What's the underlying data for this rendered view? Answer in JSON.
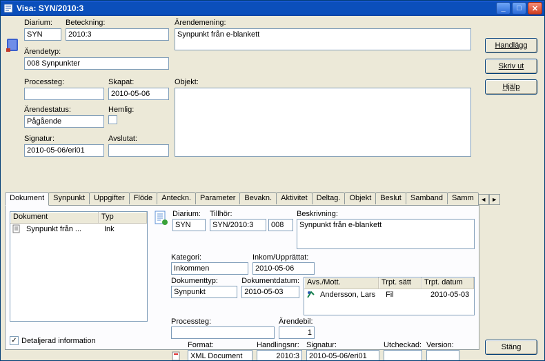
{
  "window": {
    "title": "Visa: SYN/2010:3"
  },
  "buttons": {
    "handlagg": "Handlägg",
    "skrivut": "Skriv ut",
    "hjalp": "Hjälp",
    "stang": "Stäng"
  },
  "top": {
    "labels": {
      "diarium": "Diarium:",
      "beteckning": "Beteckning:",
      "arendemening": "Ärendemening:",
      "arendetyp": "Ärendetyp:",
      "processteg": "Processteg:",
      "skapat": "Skapat:",
      "objekt": "Objekt:",
      "arendestatus": "Ärendestatus:",
      "hemlig": "Hemlig:",
      "signatur": "Signatur:",
      "avslutat": "Avslutat:"
    },
    "values": {
      "diarium": "SYN",
      "beteckning": "2010:3",
      "arendemening": "Synpunkt från e-blankett",
      "arendetyp": "008 Synpunkter",
      "processteg": "",
      "skapat": "2010-05-06",
      "objekt": "",
      "arendestatus": "Pågående",
      "signatur": "2010-05-06/eri01",
      "avslutat": ""
    }
  },
  "tabs": [
    "Dokument",
    "Synpunkt",
    "Uppgifter",
    "Flöde",
    "Anteckn.",
    "Parameter",
    "Bevakn.",
    "Aktivitet",
    "Deltag.",
    "Objekt",
    "Beslut",
    "Samband",
    "Samm"
  ],
  "activeTab": 0,
  "doclist": {
    "cols": [
      "Dokument",
      "Typ"
    ],
    "rows": [
      {
        "dokument": "Synpunkt från ...",
        "typ": "Ink"
      }
    ]
  },
  "detail": {
    "labels": {
      "diarium": "Diarium:",
      "tillhor": "Tillhör:",
      "beskrivning": "Beskrivning:",
      "kategori": "Kategori:",
      "inkom": "Inkom/Upprättat:",
      "doktyp": "Dokumenttyp:",
      "dokdatum": "Dokumentdatum:",
      "processteg": "Processteg:",
      "arendebil": "Ärendebil:",
      "format": "Format:",
      "handlingsnr": "Handlingsnr:",
      "signatur": "Signatur:",
      "utcheckad": "Utcheckad:",
      "version": "Version:"
    },
    "values": {
      "diarium": "SYN",
      "tillhor1": "SYN/2010:3",
      "tillhor2": "008",
      "beskrivning": "Synpunkt från e-blankett",
      "kategori": "Inkommen",
      "inkom": "2010-05-06",
      "doktyp": "Synpunkt",
      "dokdatum": "2010-05-03",
      "processteg": "",
      "arendebil": "1",
      "format": "XML Document",
      "handlingsnr": "2010:3",
      "signatur": "2010-05-06/eri01",
      "utcheckad": "",
      "version": ""
    },
    "recipients": {
      "cols": [
        "Avs./Mott.",
        "Trpt. sätt",
        "Trpt. datum"
      ],
      "rows": [
        {
          "name": "Andersson, Lars",
          "satt": "Fil",
          "datum": "2010-05-03"
        }
      ]
    }
  },
  "footer": {
    "detaljerad": "Detaljerad information",
    "checked": true
  }
}
